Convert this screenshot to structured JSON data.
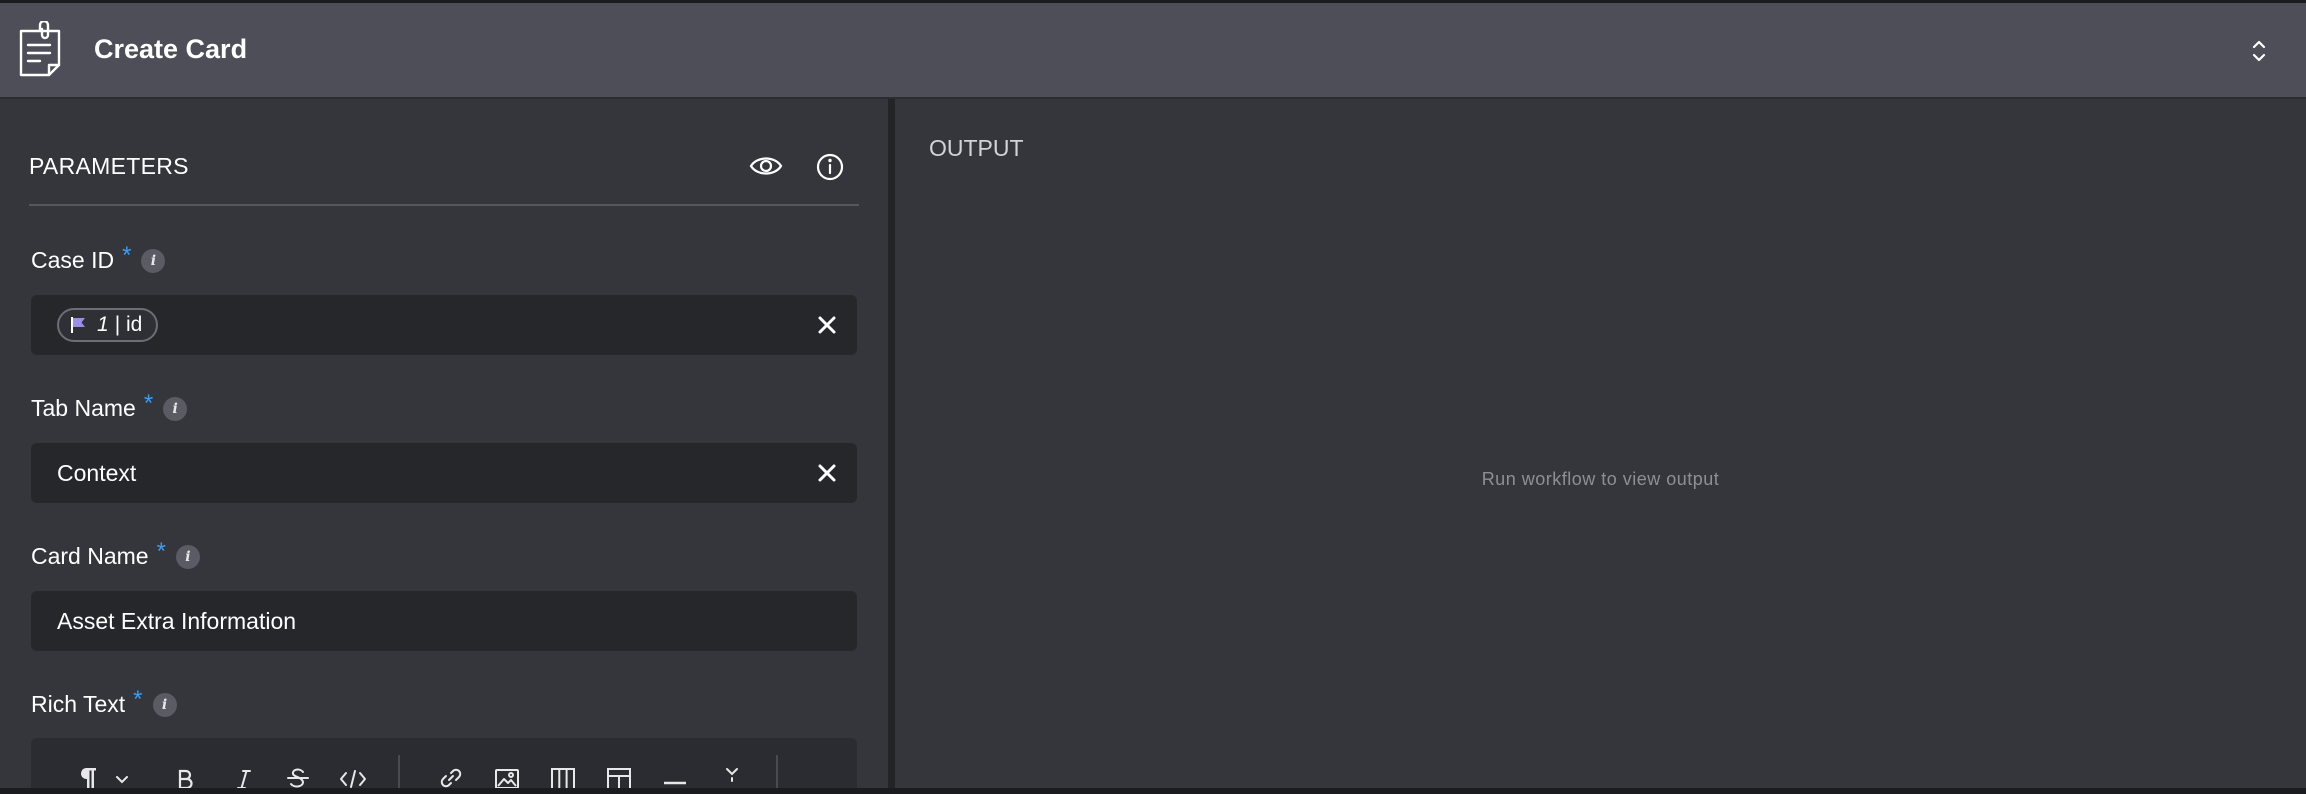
{
  "header": {
    "title": "Create Card",
    "icon": "sticky-note-icon",
    "expand_icon": "chevron-up-down-icon"
  },
  "parameters": {
    "title": "PARAMETERS",
    "preview_icon": "eye-icon",
    "info_icon": "info-icon"
  },
  "fields": {
    "case_id": {
      "label": "Case ID",
      "required_mark": "*",
      "info": "i",
      "chip": {
        "icon": "flag-icon",
        "number": "1",
        "text": "| id"
      }
    },
    "tab_name": {
      "label": "Tab Name",
      "required_mark": "*",
      "info": "i",
      "value": "Context"
    },
    "card_name": {
      "label": "Card Name",
      "required_mark": "*",
      "info": "i",
      "value": "Asset Extra Information"
    },
    "rich_text": {
      "label": "Rich Text",
      "required_mark": "*",
      "info": "i",
      "toolbar": [
        "paragraph-icon",
        "chevron-down-icon",
        "bold-icon",
        "italic-icon",
        "strikethrough-icon",
        "code-icon",
        "link-icon",
        "image-icon",
        "columns-icon",
        "table-icon",
        "horizontal-rule-icon",
        "more-icon"
      ]
    }
  },
  "output": {
    "title": "OUTPUT",
    "empty_message": "Run workflow to view output"
  },
  "colors": {
    "header_bg": "#4d4e58",
    "panel_bg": "#35363c",
    "input_bg": "#26272b",
    "required": "#3d9cf2",
    "chip_flag": "#9a8ee8"
  }
}
